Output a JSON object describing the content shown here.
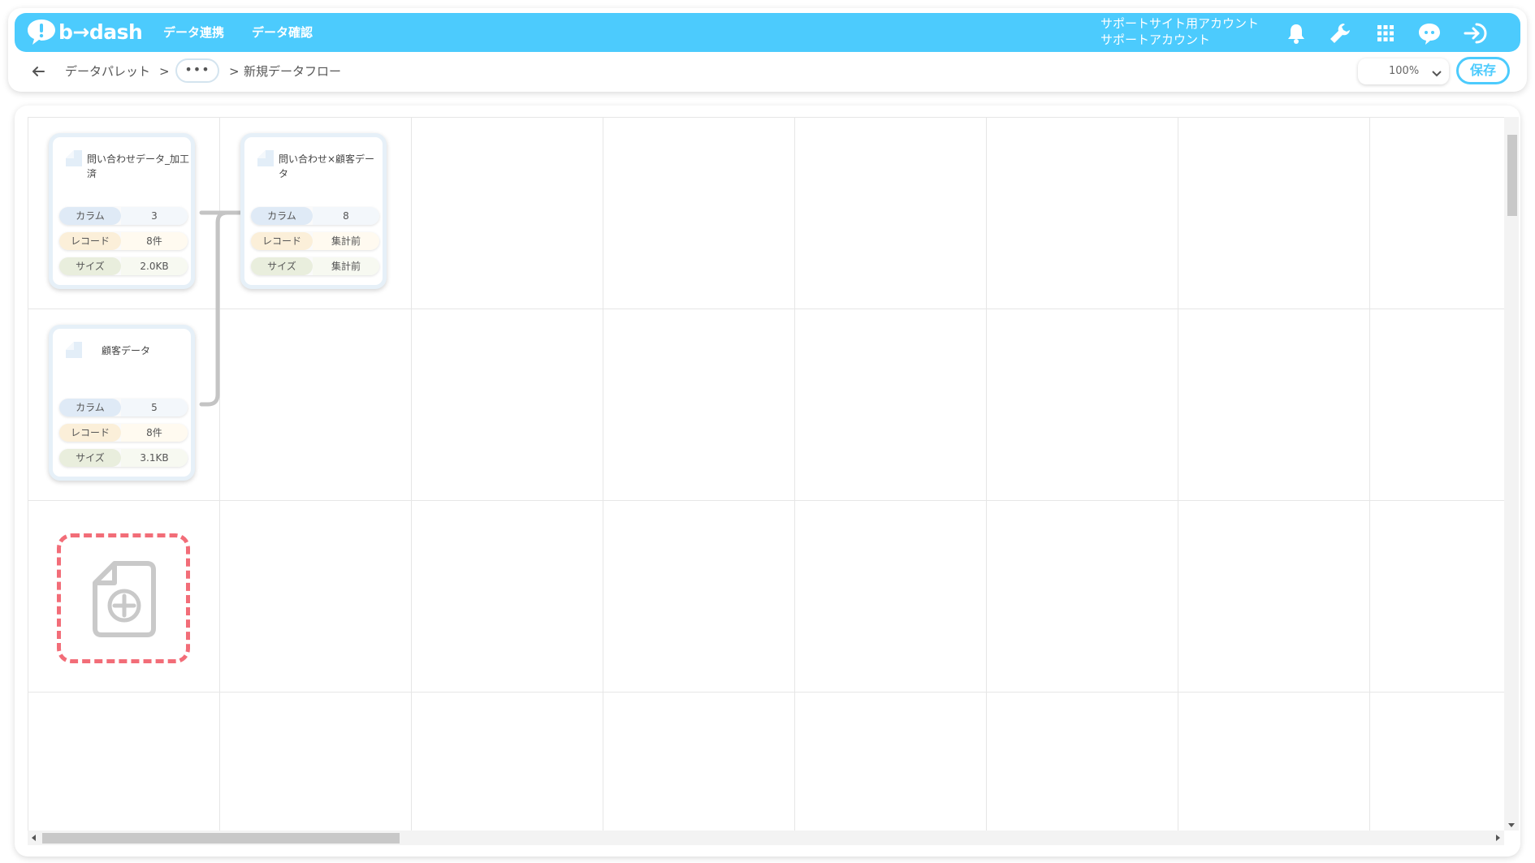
{
  "app": {
    "brand": "b→dash"
  },
  "header": {
    "nav": [
      "データ連携",
      "データ確認"
    ],
    "account_line1": "サポートサイト用アカウント",
    "account_line2": "サポートアカウント",
    "icons": [
      "bell-icon",
      "wrench-icon",
      "grid-icon",
      "chat-bot-icon",
      "logout-icon"
    ]
  },
  "breadcrumb": {
    "root": "データパレット",
    "sep1": ">",
    "ellipsis": "•••",
    "sep2": ">",
    "current": "新規データフロー"
  },
  "toolbar": {
    "zoom": "100%",
    "save_label": "保存"
  },
  "stat_labels": {
    "columns": "カラム",
    "records": "レコード",
    "size": "サイズ"
  },
  "cards": [
    {
      "title": "問い合わせデータ_加工済",
      "columns": "3",
      "records": "8件",
      "size": "2.0KB"
    },
    {
      "title": "問い合わせ×顧客データ",
      "columns": "8",
      "records": "集計前",
      "size": "集計前"
    },
    {
      "title": "顧客データ",
      "columns": "5",
      "records": "8件",
      "size": "3.1KB"
    }
  ],
  "colors": {
    "accent": "#4ccbfd",
    "add_border": "#f26d78"
  }
}
